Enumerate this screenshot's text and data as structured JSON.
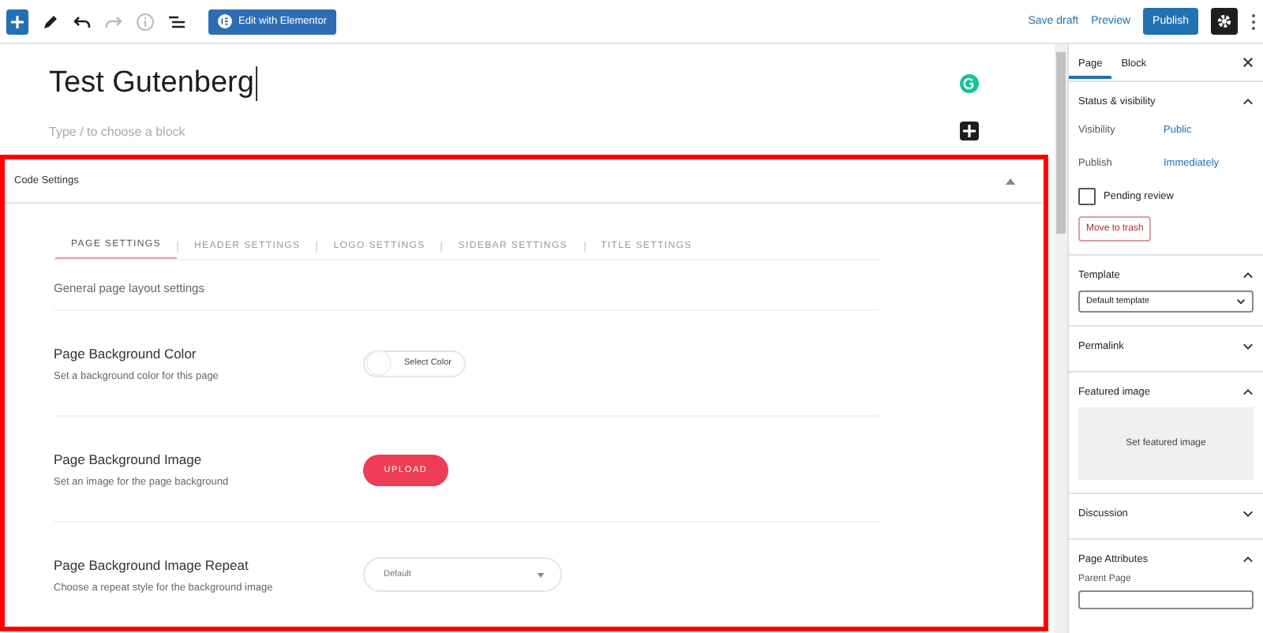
{
  "toolbar": {
    "edit_button": "Edit with Elementor",
    "save_draft": "Save draft",
    "preview": "Preview",
    "publish": "Publish"
  },
  "editor": {
    "title": "Test Gutenberg",
    "block_placeholder": "Type / to choose a block"
  },
  "code_settings": {
    "title": "Code Settings",
    "highlighted": true,
    "tabs": [
      {
        "label": "PAGE SETTINGS",
        "selected": true
      },
      {
        "label": "HEADER SETTINGS",
        "selected": false
      },
      {
        "label": "LOGO SETTINGS",
        "selected": false
      },
      {
        "label": "SIDEBAR SETTINGS",
        "selected": false
      },
      {
        "label": "TITLE SETTINGS",
        "selected": false
      }
    ],
    "intro": "General page layout settings",
    "rows": [
      {
        "kind": "color",
        "label": "Page Background Color",
        "description": "Set a background color for this page",
        "control": "Select Color"
      },
      {
        "kind": "upload",
        "label": "Page Background Image",
        "description": "Set an image for the page background",
        "control": "UPLOAD"
      },
      {
        "kind": "select",
        "label": "Page Background Image Repeat",
        "description": "Choose a repeat style for the background image",
        "control": "Default"
      }
    ]
  },
  "sidebar": {
    "tabs": [
      {
        "label": "Page",
        "selected": true
      },
      {
        "label": "Block",
        "selected": false
      }
    ],
    "status": {
      "title": "Status & visibility",
      "expanded": true,
      "fields": [
        {
          "label": "Visibility",
          "value": "Public"
        },
        {
          "label": "Publish",
          "value": "Immediately"
        }
      ],
      "pending_review": {
        "label": "Pending review",
        "checked": false
      },
      "trash": "Move to trash"
    },
    "template": {
      "title": "Template",
      "expanded": true,
      "value": "Default template"
    },
    "permalink": {
      "title": "Permalink",
      "expanded": false
    },
    "featured_image": {
      "title": "Featured image",
      "expanded": true,
      "button": "Set featured image"
    },
    "discussion": {
      "title": "Discussion",
      "expanded": false
    },
    "page_attributes": {
      "title": "Page Attributes",
      "expanded": true,
      "parent_label": "Parent Page"
    }
  }
}
